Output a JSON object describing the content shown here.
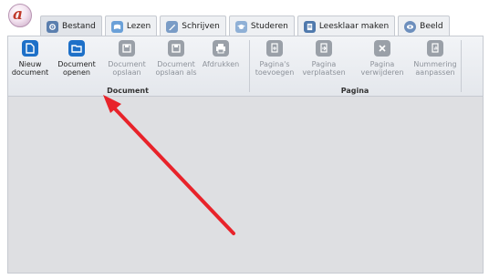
{
  "tabs": [
    {
      "label": "Bestand",
      "icon": "gear-icon",
      "active": true
    },
    {
      "label": "Lezen",
      "icon": "read-icon"
    },
    {
      "label": "Schrijven",
      "icon": "pencil-icon"
    },
    {
      "label": "Studeren",
      "icon": "graduation-cap-icon"
    },
    {
      "label": "Leesklaar maken",
      "icon": "document-prepare-icon"
    },
    {
      "label": "Beeld",
      "icon": "eye-icon"
    }
  ],
  "ribbon": {
    "document_group": {
      "label": "Document",
      "buttons": [
        {
          "label": "Nieuw\ndocument",
          "icon": "new-document-icon",
          "enabled": true
        },
        {
          "label": "Document\nopenen",
          "icon": "open-folder-icon",
          "enabled": true
        },
        {
          "label": "Document\nopslaan",
          "icon": "save-icon",
          "enabled": false
        },
        {
          "label": "Document\nopslaan als",
          "icon": "save-as-icon",
          "enabled": false
        },
        {
          "label": "Afdrukken",
          "icon": "printer-icon",
          "enabled": false
        }
      ]
    },
    "pagina_group": {
      "label": "Pagina",
      "buttons": [
        {
          "label": "Pagina's\ntoevoegen",
          "icon": "add-pages-icon",
          "enabled": false
        },
        {
          "label": "Pagina\nverplaatsen",
          "icon": "move-page-icon",
          "enabled": false
        },
        {
          "label": "Pagina\nverwijderen",
          "icon": "delete-page-icon",
          "enabled": false
        },
        {
          "label": "Nummering\naanpassen",
          "icon": "numbering-icon",
          "enabled": false
        }
      ]
    }
  },
  "colors": {
    "accent": "#1d70c8",
    "disabled_icon": "#9aa0a8",
    "annotation_arrow": "#e8232a"
  }
}
